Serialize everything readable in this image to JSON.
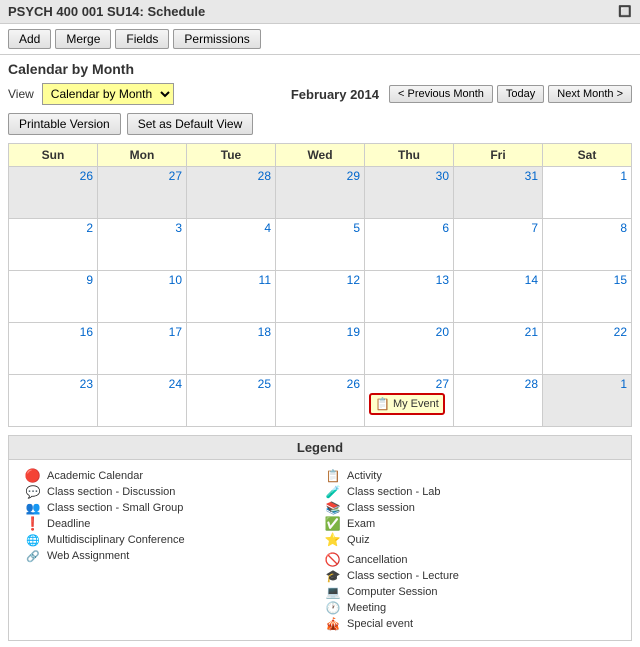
{
  "titleBar": {
    "text": "PSYCH 400 001 SU14: Schedule",
    "icon": "window-icon"
  },
  "toolbar": {
    "buttons": [
      "Add",
      "Merge",
      "Fields",
      "Permissions"
    ]
  },
  "pageTitle": "Calendar by Month",
  "viewRow": {
    "label": "View",
    "selectValue": "Calendar by Month ▼",
    "monthLabel": "February 2014",
    "prevLabel": "< Previous Month",
    "todayLabel": "Today",
    "nextLabel": "Next Month >"
  },
  "secondaryToolbar": {
    "printable": "Printable Version",
    "setDefault": "Set as Default View"
  },
  "calendar": {
    "headers": [
      "Sun",
      "Mon",
      "Tue",
      "Wed",
      "Thu",
      "Fri",
      "Sat"
    ],
    "rows": [
      [
        {
          "day": "26",
          "other": true
        },
        {
          "day": "27",
          "other": true
        },
        {
          "day": "28",
          "other": true
        },
        {
          "day": "29",
          "other": true
        },
        {
          "day": "30",
          "other": true
        },
        {
          "day": "31",
          "other": true
        },
        {
          "day": "1",
          "other": false,
          "rightAlign": true
        }
      ],
      [
        {
          "day": "2",
          "other": false
        },
        {
          "day": "3",
          "other": false
        },
        {
          "day": "4",
          "other": false
        },
        {
          "day": "5",
          "other": false
        },
        {
          "day": "6",
          "other": false
        },
        {
          "day": "7",
          "other": false
        },
        {
          "day": "8",
          "other": false
        }
      ],
      [
        {
          "day": "9",
          "other": false
        },
        {
          "day": "10",
          "other": false
        },
        {
          "day": "11",
          "other": false
        },
        {
          "day": "12",
          "other": false
        },
        {
          "day": "13",
          "other": false
        },
        {
          "day": "14",
          "other": false
        },
        {
          "day": "15",
          "other": false
        }
      ],
      [
        {
          "day": "16",
          "other": false
        },
        {
          "day": "17",
          "other": false
        },
        {
          "day": "18",
          "other": false
        },
        {
          "day": "19",
          "other": false
        },
        {
          "day": "20",
          "other": false
        },
        {
          "day": "21",
          "other": false
        },
        {
          "day": "22",
          "other": false
        }
      ],
      [
        {
          "day": "23",
          "other": false
        },
        {
          "day": "24",
          "other": false
        },
        {
          "day": "25",
          "other": false
        },
        {
          "day": "26",
          "other": false
        },
        {
          "day": "27",
          "other": false,
          "hasEvent": true,
          "eventLabel": "My Event"
        },
        {
          "day": "28",
          "other": false
        },
        {
          "day": "1",
          "other": true
        }
      ]
    ]
  },
  "legend": {
    "title": "Legend",
    "col1": [
      {
        "icon": "fire",
        "label": "Academic Calendar"
      },
      {
        "icon": "discuss",
        "label": "Class section - Discussion"
      },
      {
        "icon": "smallgroup",
        "label": "Class section - Small Group"
      },
      {
        "icon": "deadline",
        "label": "Deadline"
      },
      {
        "icon": "multiconf",
        "label": "Multidisciplinary Conference"
      },
      {
        "icon": "webassign",
        "label": "Web Assignment"
      }
    ],
    "col2": [
      {
        "icon": "activity",
        "label": "Activity"
      },
      {
        "icon": "classlab",
        "label": "Class section - Lab"
      },
      {
        "icon": "classsession",
        "label": "Class session"
      },
      {
        "icon": "exam",
        "label": "Exam"
      },
      {
        "icon": "quiz",
        "label": "Quiz"
      },
      {
        "icon": "cancel",
        "label": "Cancellation"
      },
      {
        "icon": "lecture",
        "label": "Class section - Lecture"
      },
      {
        "icon": "computer",
        "label": "Computer Session"
      },
      {
        "icon": "meeting",
        "label": "Meeting"
      },
      {
        "icon": "special",
        "label": "Special event"
      }
    ]
  }
}
